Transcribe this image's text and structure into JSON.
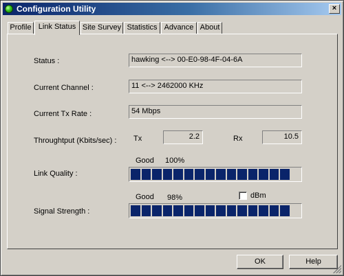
{
  "window": {
    "title": "Configuration Utility",
    "close_glyph": "×",
    "app_icon": "green-status-orb-icon"
  },
  "tabs": [
    {
      "label": "Profile",
      "active": false
    },
    {
      "label": "Link Status",
      "active": true
    },
    {
      "label": "Site Survey",
      "active": false
    },
    {
      "label": "Statistics",
      "active": false
    },
    {
      "label": "Advance",
      "active": false
    },
    {
      "label": "About",
      "active": false
    }
  ],
  "link_status": {
    "status": {
      "label": "Status :",
      "value": "hawking <--> 00-E0-98-4F-04-6A"
    },
    "channel": {
      "label": "Current Channel :",
      "value": "11 <--> 2462000 KHz"
    },
    "tx_rate": {
      "label": "Current Tx Rate :",
      "value": "54 Mbps"
    },
    "throughput": {
      "label": "Throughtput (Kbits/sec) :",
      "tx_label": "Tx",
      "tx_value": "2.2",
      "rx_label": "Rx",
      "rx_value": "10.5"
    },
    "link_quality": {
      "label": "Link Quality :",
      "rating": "Good",
      "percent_text": "100%",
      "level_percent": 100,
      "segments": 15,
      "bar_color": "#0a246a"
    },
    "signal_strength": {
      "label": "Signal Strength :",
      "rating": "Good",
      "percent_text": "98%",
      "level_percent": 98,
      "segments": 15,
      "bar_color": "#0a246a",
      "dbm_label": "dBm",
      "dbm_checked": false
    }
  },
  "buttons": {
    "ok": "OK",
    "help": "Help"
  }
}
